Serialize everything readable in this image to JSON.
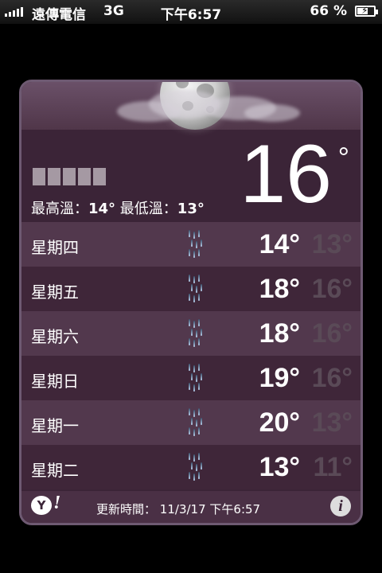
{
  "status_bar": {
    "carrier": "遠傳電信",
    "network": "3G",
    "time": "下午6:57",
    "battery_percent": "66 %",
    "battery_level": 0.66
  },
  "weather": {
    "condition_icon": "moon-cloud",
    "current_temp": "16",
    "degree_symbol": "°",
    "hi_label": "最高溫：",
    "hi_value": "14°",
    "lo_label": "最低溫：",
    "lo_value": "13°",
    "forecast": [
      {
        "day": "星期四",
        "icon": "rain-icon",
        "high": "14°",
        "low": "13°"
      },
      {
        "day": "星期五",
        "icon": "rain-icon",
        "high": "18°",
        "low": "16°"
      },
      {
        "day": "星期六",
        "icon": "rain-icon",
        "high": "18°",
        "low": "16°"
      },
      {
        "day": "星期日",
        "icon": "rain-icon",
        "high": "19°",
        "low": "16°"
      },
      {
        "day": "星期一",
        "icon": "rain-icon",
        "high": "20°",
        "low": "13°"
      },
      {
        "day": "星期二",
        "icon": "rain-icon",
        "high": "13°",
        "low": "11°"
      }
    ]
  },
  "footer": {
    "yahoo_logo": "Y!",
    "updated_label": "更新時間：",
    "updated_date": "11/3/17",
    "updated_time": "下午6:57"
  },
  "colors": {
    "card_bg": "#3b2437",
    "row_light": "#52384d",
    "row_dark": "#3f2639",
    "low_temp": "#5a4a57"
  }
}
